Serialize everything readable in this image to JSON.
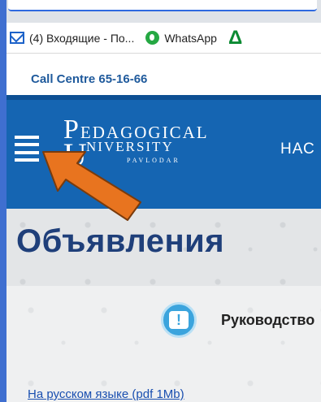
{
  "browser": {
    "bookmarks": [
      {
        "label": "(4) Входящие - По...",
        "icon": "mail-icon"
      },
      {
        "label": "WhatsApp",
        "icon": "whatsapp-icon"
      },
      {
        "label": "",
        "icon": "delta-icon"
      }
    ]
  },
  "site": {
    "call_centre": "Call Centre 65-16-66",
    "logo": {
      "p": "P",
      "edagogical": "EDAGOGICAL",
      "u": "U",
      "niversity": "NIVERSITY",
      "city": "PAVLODAR"
    },
    "nav_partial": "НАС",
    "page_title": "Объявления",
    "notice_text": "Руководство",
    "notice_icon": "!",
    "pdf_link": "На русском языке (pdf 1Mb)"
  },
  "colors": {
    "header_blue": "#1565b2",
    "title_navy": "#1f3f7a",
    "arrow_orange": "#e8741f"
  }
}
